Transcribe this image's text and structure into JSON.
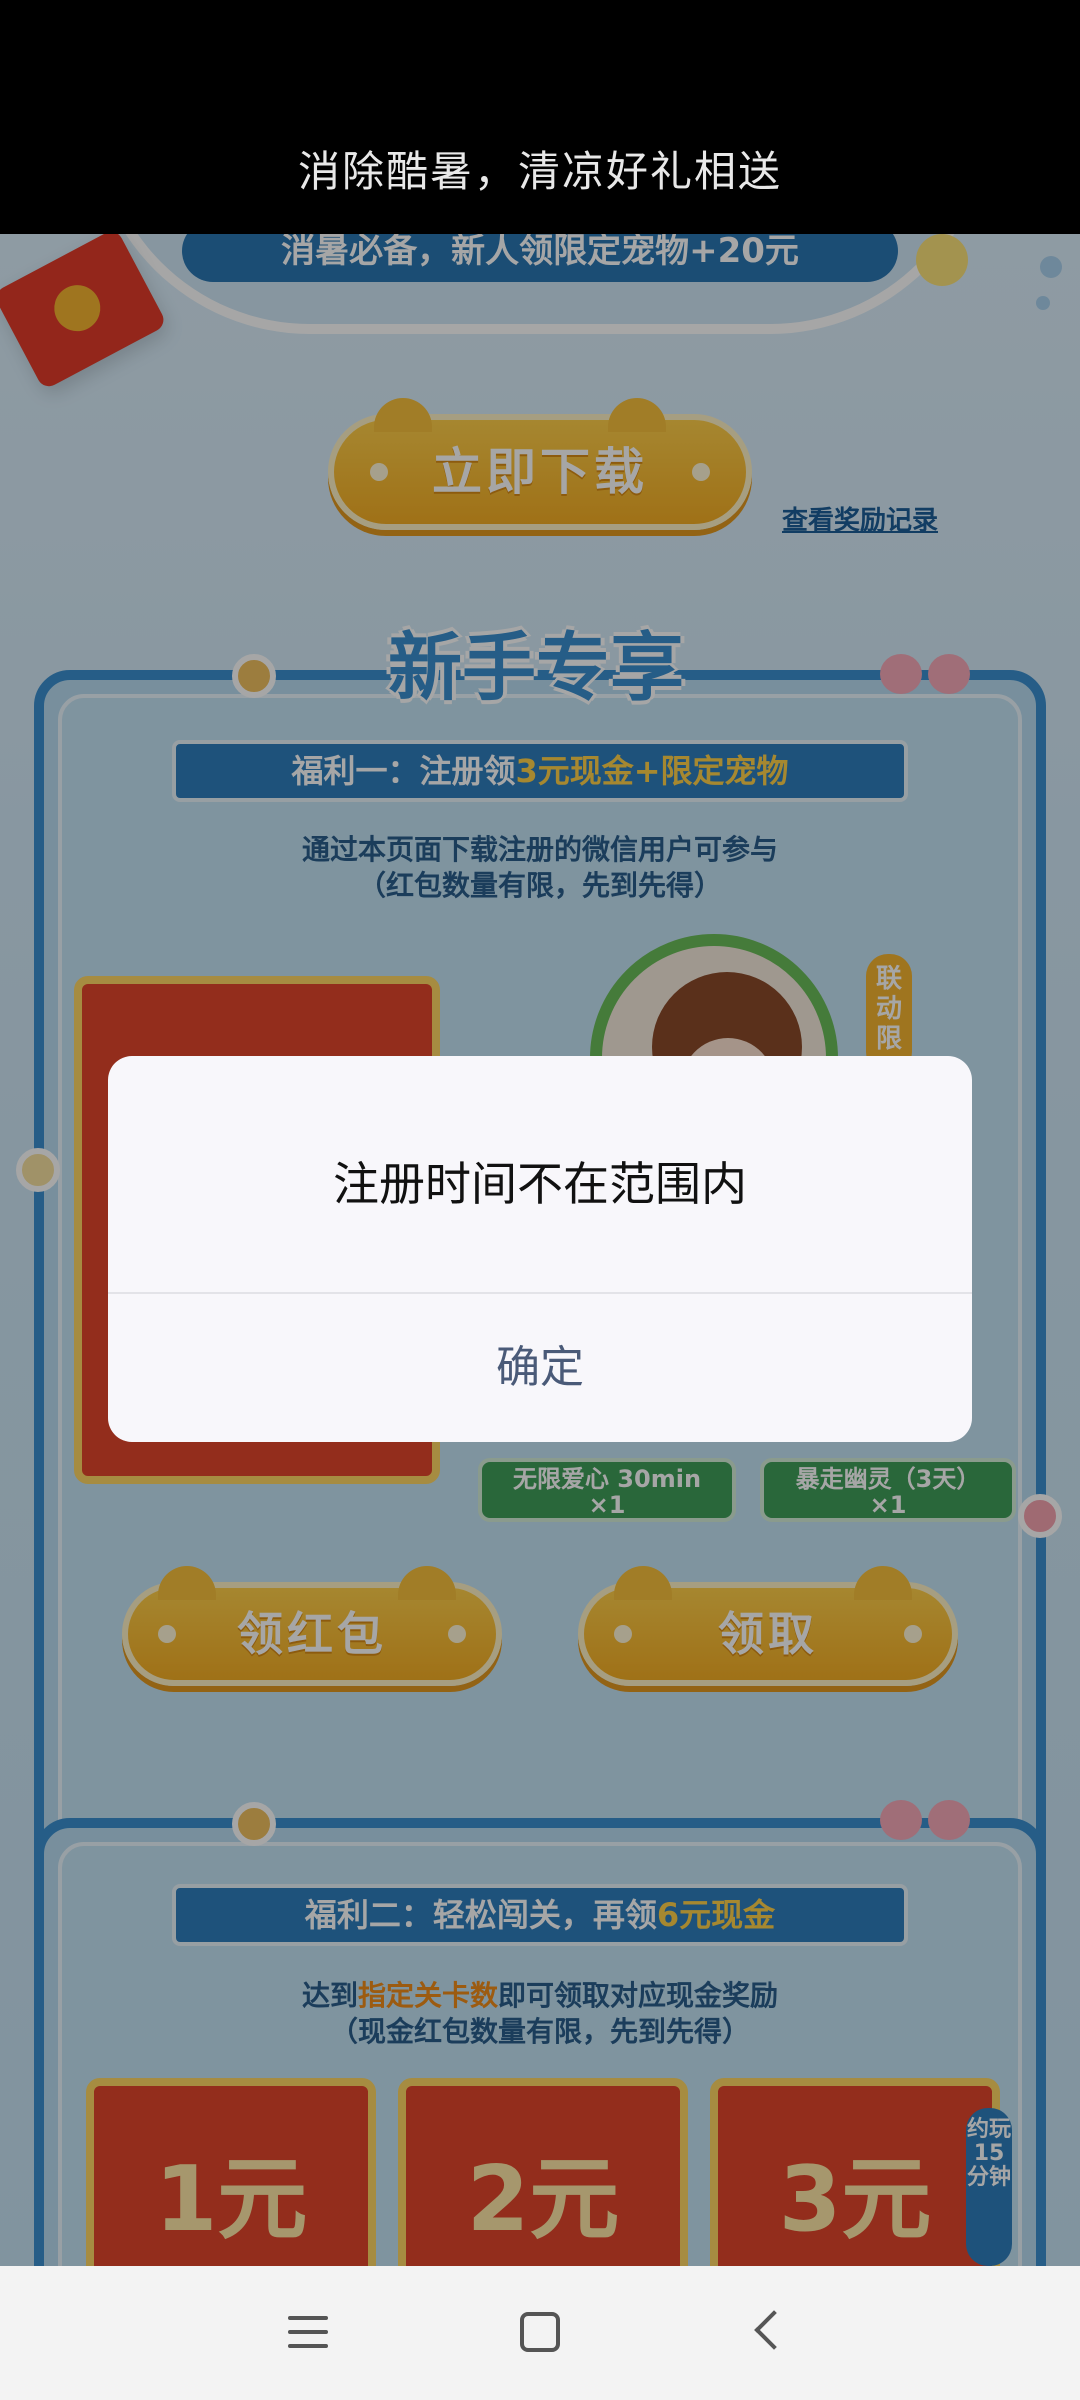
{
  "header": {
    "title": "消除酷暑，清凉好礼相送"
  },
  "top": {
    "banner_text": "消暑必备，新人领限定宠物+20元",
    "download_button": "立即下载",
    "reward_link": "查看奖励记录"
  },
  "newbie": {
    "title": "新手专享",
    "benefit1": {
      "prefix": "福利一：注册领",
      "amount": "3元现金+限定宠物"
    },
    "desc1_line1": "通过本页面下载注册的微信用户可参与",
    "desc1_line2": "（红包数量有限，先到先得）",
    "side_tag": "联动限",
    "item1": {
      "name": "无限爱心 30min",
      "qty": "×1"
    },
    "item2": {
      "name": "暴走幽灵（3天）",
      "qty": "×1"
    },
    "btn_red_packet": "领红包",
    "btn_claim": "领取"
  },
  "benefit2": {
    "prefix": "福利二：轻松闯关，再领",
    "amount": "6元现金",
    "desc_pre": "达到",
    "desc_hl": "指定关卡数",
    "desc_post": "即可领取对应现金奖励",
    "desc_line2": "（现金红包数量有限，先到先得）",
    "cards": [
      "1元",
      "2元",
      "3元"
    ],
    "side_tag": "约玩15分钟"
  },
  "dialog": {
    "message": "注册时间不在范围内",
    "confirm": "确定"
  },
  "colors": {
    "accent_blue": "#3b8fcf",
    "button_yellow": "#f5ae24",
    "card_red": "#e2452c",
    "dialog_button_text": "#4a5a78"
  },
  "nav": {
    "icons": [
      "menu-icon",
      "home-icon",
      "back-icon"
    ]
  }
}
